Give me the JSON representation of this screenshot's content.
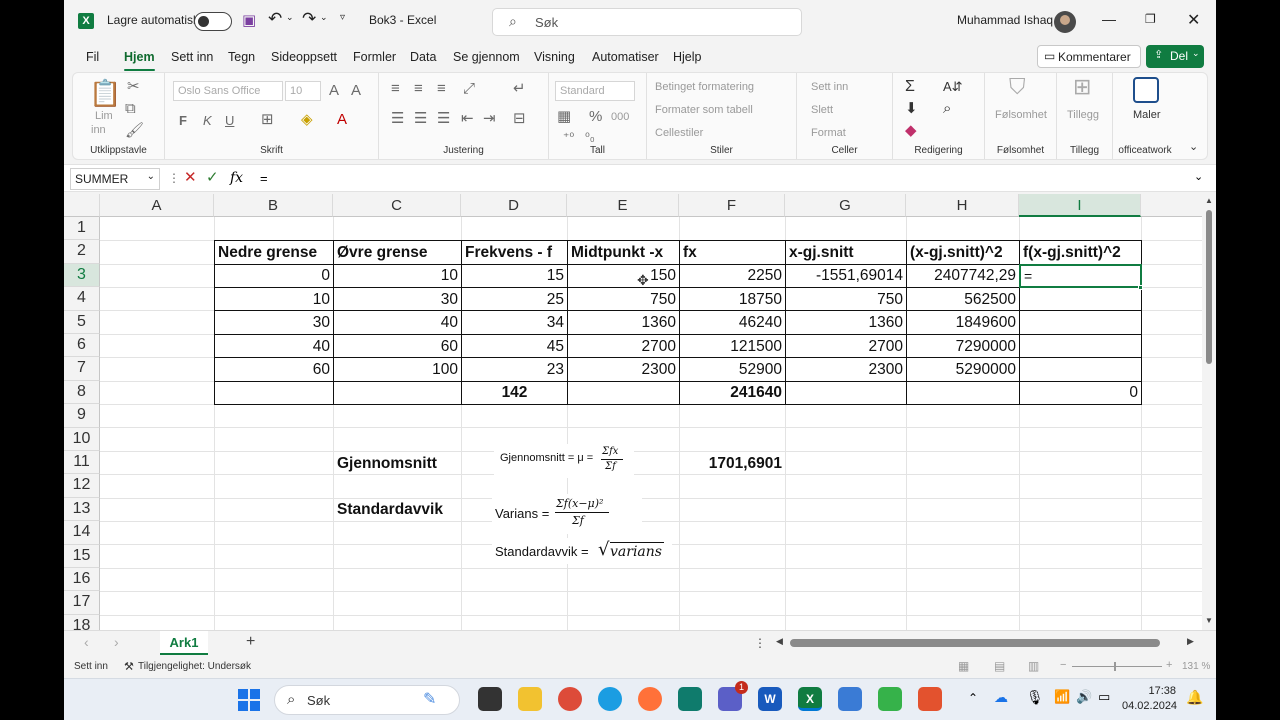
{
  "titlebar": {
    "autosave_label": "Lagre automatisk",
    "doc_title": "Bok3  -  Excel",
    "search_placeholder": "Søk",
    "user_name": "Muhammad Ishaq"
  },
  "menu": [
    "Fil",
    "Hjem",
    "Sett inn",
    "Tegn",
    "Sideoppsett",
    "Formler",
    "Data",
    "Se gjennom",
    "Visning",
    "Automatiser",
    "Hjelp"
  ],
  "menu_active": "Hjem",
  "buttons": {
    "comment": "Kommentarer",
    "share": "Del"
  },
  "ribbon": {
    "clipboard": {
      "label": "Utklippstavle",
      "paste": "Lim",
      "paste2": "inn"
    },
    "font": {
      "label": "Skrift",
      "name": "Oslo Sans Office",
      "size": "10",
      "bold": "F",
      "italic": "K",
      "underline": "U"
    },
    "alignment": {
      "label": "Justering"
    },
    "number": {
      "label": "Tall",
      "format": "Standard"
    },
    "styles": {
      "label": "Stiler",
      "items": [
        "Betinget formatering",
        "Formater som tabell",
        "Cellestiler"
      ]
    },
    "cells": {
      "label": "Celler",
      "items": [
        "Sett inn",
        "Slett",
        "Format"
      ]
    },
    "editing": {
      "label": "Redigering"
    },
    "sensitivity": {
      "label": "Følsomhet",
      "btn": "Følsomhet"
    },
    "addins": {
      "label": "Tillegg",
      "btn": "Tillegg"
    },
    "officeatwork": {
      "label": "officeatwork",
      "btn": "Maler"
    }
  },
  "formula_bar": {
    "name_box": "SUMMER",
    "content": "="
  },
  "columns": [
    "A",
    "B",
    "C",
    "D",
    "E",
    "F",
    "G",
    "H",
    "I"
  ],
  "selected_column": "I",
  "rows": [
    "1",
    "2",
    "3",
    "4",
    "5",
    "6",
    "7",
    "8",
    "9",
    "10",
    "11",
    "12",
    "13",
    "14",
    "15",
    "16",
    "17",
    "18"
  ],
  "selected_row": "3",
  "table": {
    "headers": [
      "Nedre grense",
      "Øvre grense",
      "Frekvens - f",
      "Midtpunkt -x",
      "fx",
      "x-gj.snitt",
      "(x-gj.snitt)^2",
      "f(x-gj.snitt)^2"
    ],
    "rows": [
      [
        "0",
        "10",
        "15",
        "150",
        "2250",
        "-1551,69014",
        "2407742,29",
        "="
      ],
      [
        "10",
        "30",
        "25",
        "750",
        "18750",
        "750",
        "562500",
        ""
      ],
      [
        "30",
        "40",
        "34",
        "1360",
        "46240",
        "1360",
        "1849600",
        ""
      ],
      [
        "40",
        "60",
        "45",
        "2700",
        "121500",
        "2700",
        "7290000",
        ""
      ],
      [
        "60",
        "100",
        "23",
        "2300",
        "52900",
        "2300",
        "5290000",
        ""
      ]
    ],
    "totals": {
      "frequency": "142",
      "fx": "241640",
      "last": "0"
    }
  },
  "labels": {
    "mean": "Gjennomsnitt",
    "mean_value": "1701,6901",
    "stdev": "Standardavvik"
  },
  "formulas": {
    "mean_prefix": "Gjennomsnitt = μ =",
    "mean_num": "Σfx",
    "mean_den": "Σf",
    "variance_prefix": "Varians =",
    "variance_num": "Σf(x−μ)²",
    "variance_den": "Σf",
    "stdev_prefix": "Standardavvik =",
    "stdev_root": "varians"
  },
  "sheet_tabs": [
    "Ark1"
  ],
  "status": {
    "mode": "Sett inn",
    "accessibility": "Tilgjengelighet: Undersøk",
    "zoom": "131 %"
  },
  "taskbar": {
    "search": "Søk",
    "time": "17:38",
    "date": "04.02.2024",
    "teams_badge": "1"
  }
}
